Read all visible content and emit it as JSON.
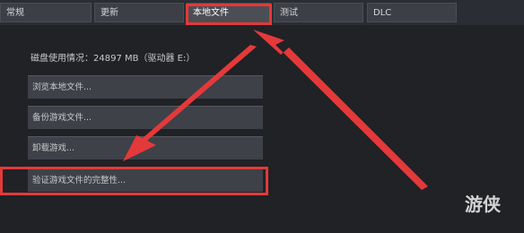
{
  "tabs": [
    {
      "label": "常规"
    },
    {
      "label": "更新"
    },
    {
      "label": "本地文件",
      "active": true
    },
    {
      "label": "测试"
    },
    {
      "label": "DLC"
    }
  ],
  "local_files": {
    "disk_usage": "磁盘使用情况：24897 MB（驱动器 E:）",
    "buttons": [
      {
        "label": "浏览本地文件..."
      },
      {
        "label": "备份游戏文件..."
      },
      {
        "label": "卸载游戏..."
      },
      {
        "label": "验证游戏文件的完整性..."
      }
    ]
  },
  "watermark": "游侠",
  "colors": {
    "highlight": "#e4393a",
    "background": "#1b1c1f",
    "button": "#3e4147"
  }
}
